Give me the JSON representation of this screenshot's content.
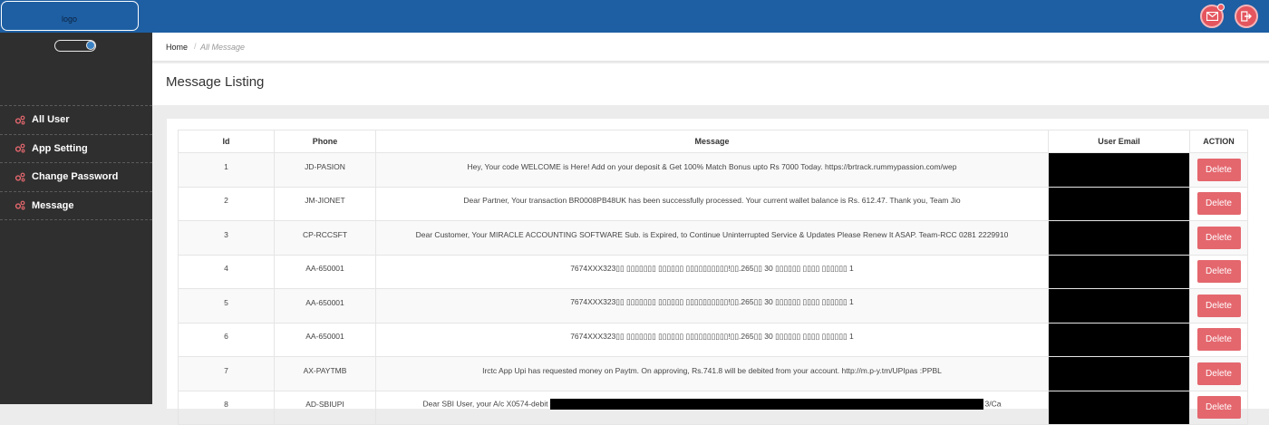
{
  "header": {
    "logo_text": "logo",
    "colors": {
      "bar": "#1e5fa3",
      "accent": "#e4555e"
    },
    "icons": [
      "mail-icon",
      "logout-icon"
    ]
  },
  "sidebar": {
    "items": [
      {
        "label": "All User",
        "icon": "gears-icon"
      },
      {
        "label": "App Setting",
        "icon": "gears-icon"
      },
      {
        "label": "Change Password",
        "icon": "gears-icon"
      },
      {
        "label": "Message",
        "icon": "gears-icon"
      }
    ]
  },
  "breadcrumb": {
    "home": "Home",
    "separator": "/",
    "current": "All Message"
  },
  "page": {
    "title": "Message Listing"
  },
  "table": {
    "columns": [
      "Id",
      "Phone",
      "Message",
      "User Email",
      "ACTION"
    ],
    "delete_label": "Delete",
    "rows": [
      {
        "id": "1",
        "phone": "JD-PASION",
        "message": "Hey, Your code WELCOME is Here! Add on your deposit & Get 100% Match Bonus upto Rs 7000 Today. https://brtrack.rummypassion.com/wep"
      },
      {
        "id": "2",
        "phone": "JM-JIONET",
        "message": "Dear Partner, Your transaction BR0008PB48UK has been successfully processed. Your current wallet balance is Rs. 612.47. Thank you, Team Jio"
      },
      {
        "id": "3",
        "phone": "CP-RCCSFT",
        "message": "Dear Customer, Your MIRACLE ACCOUNTING SOFTWARE Sub. is Expired, to Continue Uninterrupted Service & Updates Please Renew It ASAP. Team-RCC 0281 2229910"
      },
      {
        "id": "4",
        "phone": "AA-650001",
        "message": "7674XXX323▯▯ ▯▯▯▯▯▯▯ ▯▯▯▯▯▯ ▯▯▯▯▯▯▯▯▯▯!▯▯.265▯▯ 30 ▯▯▯▯▯▯ ▯▯▯▯ ▯▯▯▯▯▯ 1"
      },
      {
        "id": "5",
        "phone": "AA-650001",
        "message": "7674XXX323▯▯ ▯▯▯▯▯▯▯ ▯▯▯▯▯▯ ▯▯▯▯▯▯▯▯▯▯!▯▯.265▯▯ 30 ▯▯▯▯▯▯ ▯▯▯▯ ▯▯▯▯▯▯ 1"
      },
      {
        "id": "6",
        "phone": "AA-650001",
        "message": "7674XXX323▯▯ ▯▯▯▯▯▯▯ ▯▯▯▯▯▯ ▯▯▯▯▯▯▯▯▯▯!▯▯.265▯▯ 30 ▯▯▯▯▯▯ ▯▯▯▯ ▯▯▯▯▯▯ 1"
      },
      {
        "id": "7",
        "phone": "AX-PAYTMB",
        "message": "Irctc App Upi has requested money on Paytm. On approving, Rs.741.8 will be debited from your account. http://m.p-y.tm/UPIpas :PPBL"
      },
      {
        "id": "8",
        "phone": "AD-SBIUPI",
        "message_before": "Dear SBI User, your A/c X0574-debit",
        "message_after": "3/Ca"
      }
    ]
  }
}
